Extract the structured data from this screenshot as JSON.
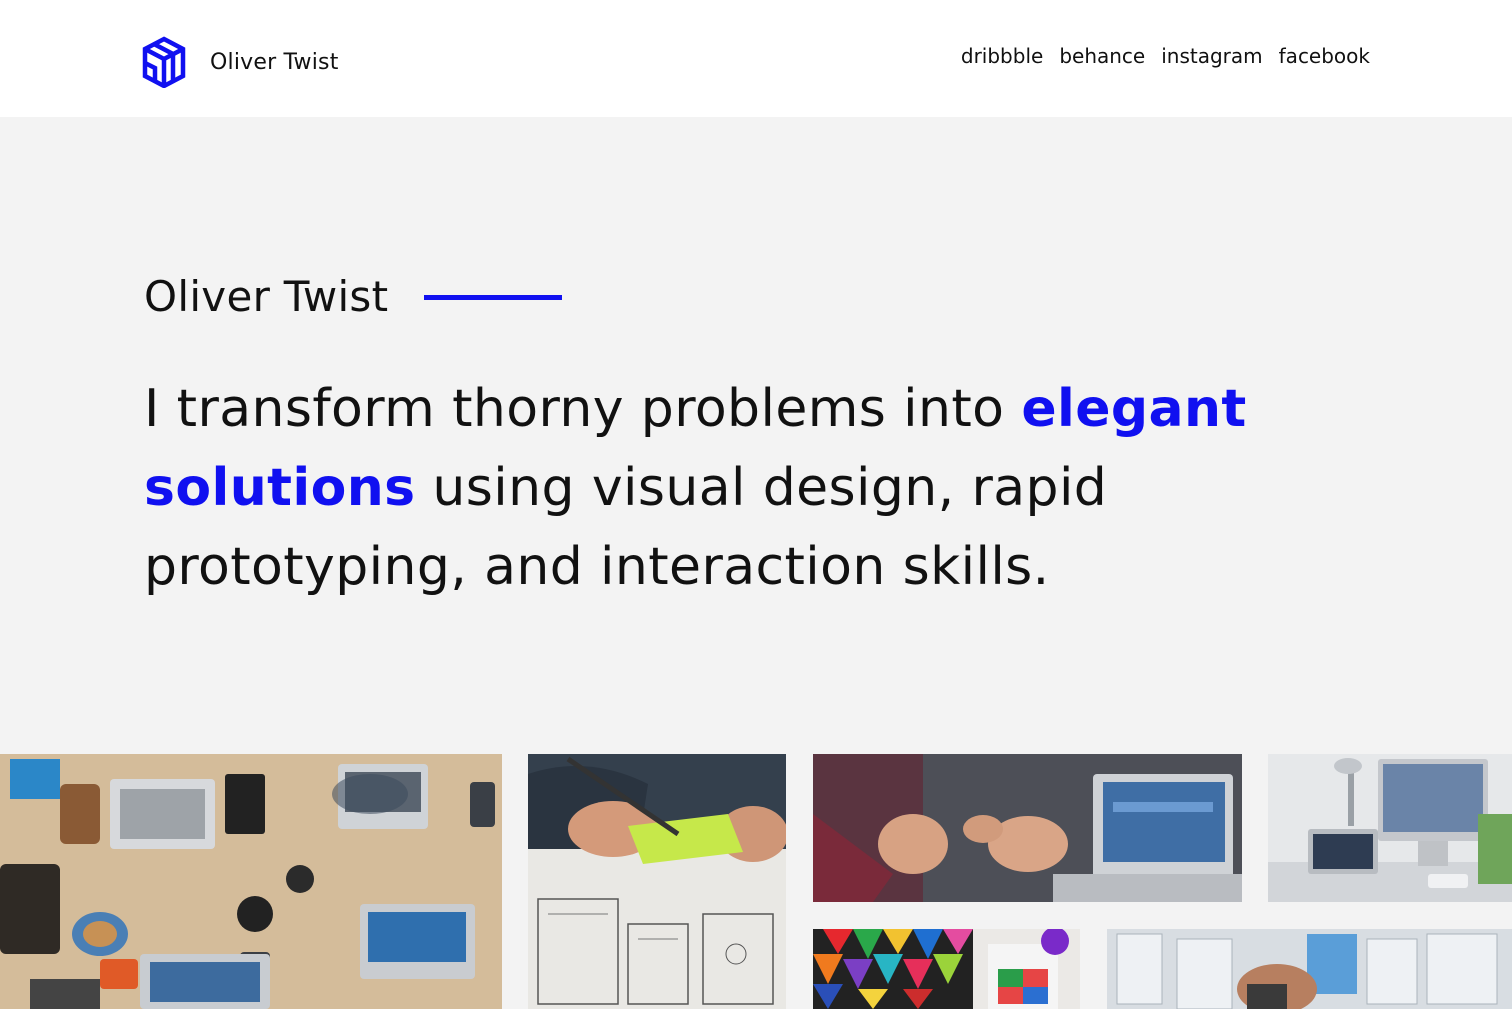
{
  "brand": {
    "logo_icon": "cube-logo-icon",
    "name": "Oliver Twist",
    "accent_color": "#1010f0"
  },
  "nav": {
    "links": [
      "dribbble",
      "behance",
      "instagram",
      "facebook"
    ]
  },
  "hero": {
    "name": "Oliver Twist",
    "headline_before": "I transform thorny problems into ",
    "headline_accent": "elegant solutions",
    "headline_after": " using visual design, rapid prototyping, and interaction skills."
  },
  "gallery": {
    "images": [
      "team-laptops-photo",
      "sketching-wireframes-photo",
      "laptop-discussion-photo",
      "desk-imac-photo",
      "color-swatches-photo",
      "wall-wireframes-photo"
    ]
  }
}
